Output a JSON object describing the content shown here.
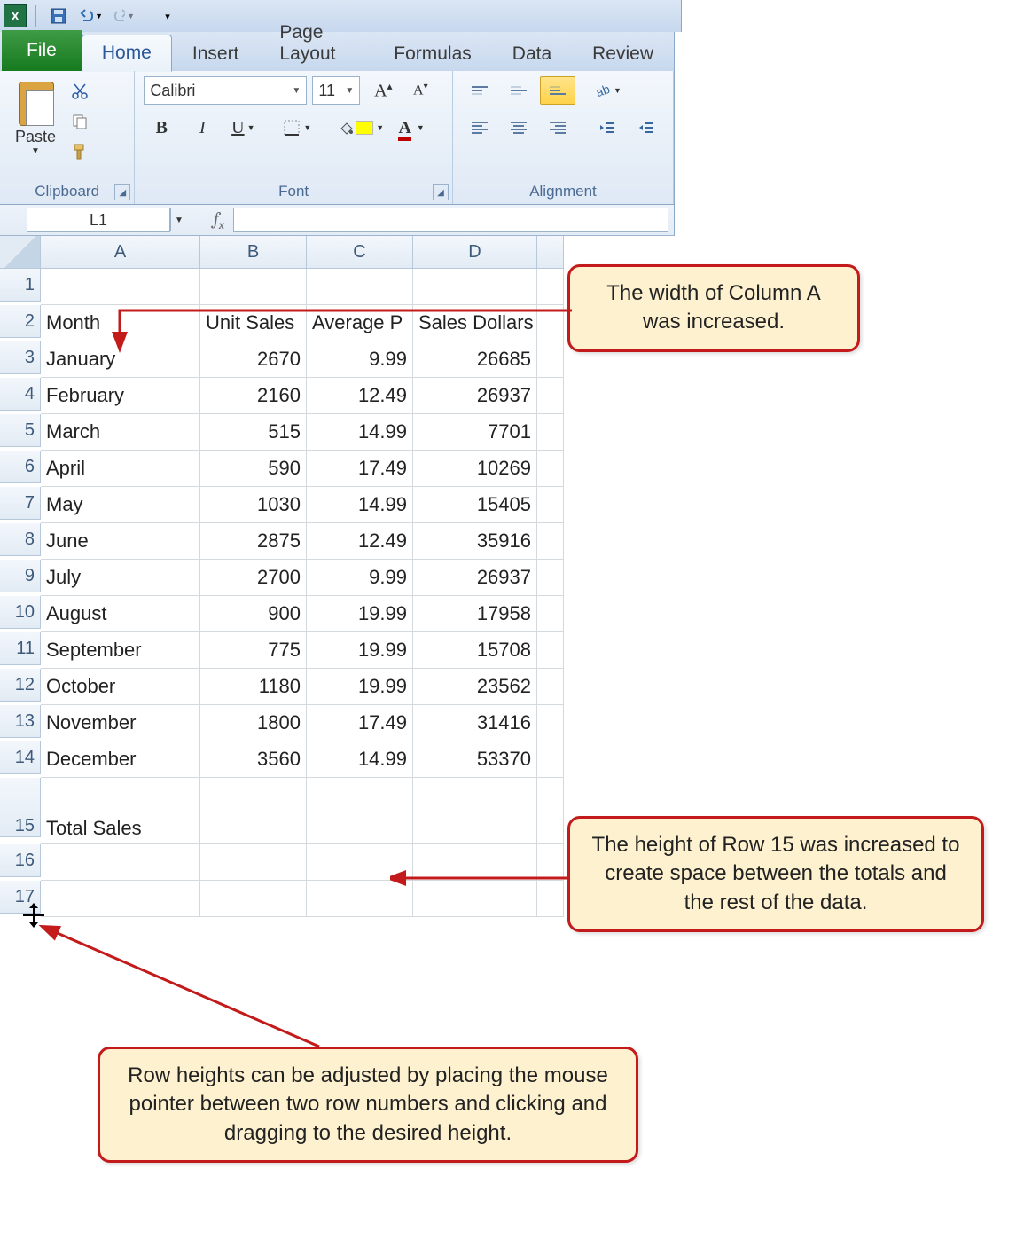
{
  "qat": {
    "app_icon_text": "X",
    "buttons": [
      "save",
      "undo",
      "redo"
    ]
  },
  "tabs": {
    "file": "File",
    "items": [
      "Home",
      "Insert",
      "Page Layout",
      "Formulas",
      "Data",
      "Review"
    ],
    "active": "Home"
  },
  "ribbon": {
    "clipboard": {
      "paste": "Paste",
      "label": "Clipboard"
    },
    "font": {
      "label": "Font",
      "name": "Calibri",
      "size": "11"
    },
    "alignment": {
      "label": "Alignment"
    }
  },
  "name_box": "L1",
  "formula_bar": "",
  "columns": [
    "A",
    "B",
    "C",
    "D",
    ""
  ],
  "headers": {
    "A": "Month",
    "B": "Unit Sales",
    "C": "Average P",
    "D": "Sales Dollars"
  },
  "rows": [
    {
      "n": 1,
      "A": "",
      "B": "",
      "C": "",
      "D": ""
    },
    {
      "n": 2,
      "A": "Month",
      "B": "Unit Sales",
      "C": "Average P",
      "D": "Sales Dollars"
    },
    {
      "n": 3,
      "A": "January",
      "B": "2670",
      "C": "9.99",
      "D": "26685"
    },
    {
      "n": 4,
      "A": "February",
      "B": "2160",
      "C": "12.49",
      "D": "26937"
    },
    {
      "n": 5,
      "A": "March",
      "B": "515",
      "C": "14.99",
      "D": "7701"
    },
    {
      "n": 6,
      "A": "April",
      "B": "590",
      "C": "17.49",
      "D": "10269"
    },
    {
      "n": 7,
      "A": "May",
      "B": "1030",
      "C": "14.99",
      "D": "15405"
    },
    {
      "n": 8,
      "A": "June",
      "B": "2875",
      "C": "12.49",
      "D": "35916"
    },
    {
      "n": 9,
      "A": "July",
      "B": "2700",
      "C": "9.99",
      "D": "26937"
    },
    {
      "n": 10,
      "A": "August",
      "B": "900",
      "C": "19.99",
      "D": "17958"
    },
    {
      "n": 11,
      "A": "September",
      "B": "775",
      "C": "19.99",
      "D": "15708"
    },
    {
      "n": 12,
      "A": "October",
      "B": "1180",
      "C": "19.99",
      "D": "23562"
    },
    {
      "n": 13,
      "A": "November",
      "B": "1800",
      "C": "17.49",
      "D": "31416"
    },
    {
      "n": 14,
      "A": "December",
      "B": "3560",
      "C": "14.99",
      "D": "53370"
    },
    {
      "n": 15,
      "A": "Total Sales",
      "B": "",
      "C": "",
      "D": "",
      "tall": true
    },
    {
      "n": 16,
      "A": "",
      "B": "",
      "C": "",
      "D": ""
    },
    {
      "n": 17,
      "A": "",
      "B": "",
      "C": "",
      "D": ""
    }
  ],
  "callouts": {
    "c1": "The width of Column A was increased.",
    "c2": "The height of Row 15 was increased to create space between the totals and the rest of the data.",
    "c3": "Row heights can be adjusted by placing the mouse pointer between two row numbers and clicking and dragging to the desired height."
  },
  "chart_data": {
    "type": "table",
    "title": "Monthly Unit Sales, Average Price, Sales Dollars",
    "columns": [
      "Month",
      "Unit Sales",
      "Average Price",
      "Sales Dollars"
    ],
    "rows": [
      [
        "January",
        2670,
        9.99,
        26685
      ],
      [
        "February",
        2160,
        12.49,
        26937
      ],
      [
        "March",
        515,
        14.99,
        7701
      ],
      [
        "April",
        590,
        17.49,
        10269
      ],
      [
        "May",
        1030,
        14.99,
        15405
      ],
      [
        "June",
        2875,
        12.49,
        35916
      ],
      [
        "July",
        2700,
        9.99,
        26937
      ],
      [
        "August",
        900,
        19.99,
        17958
      ],
      [
        "September",
        775,
        19.99,
        15708
      ],
      [
        "October",
        1180,
        19.99,
        23562
      ],
      [
        "November",
        1800,
        17.49,
        31416
      ],
      [
        "December",
        3560,
        14.99,
        53370
      ]
    ]
  }
}
